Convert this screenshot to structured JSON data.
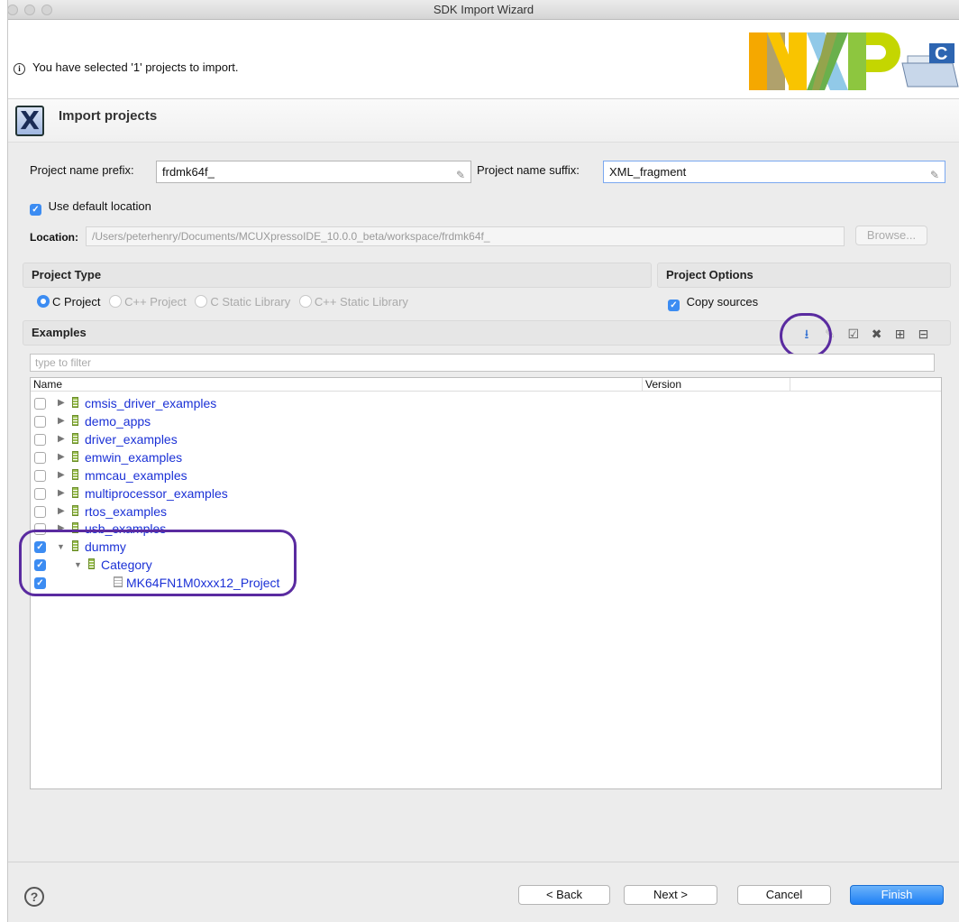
{
  "window": {
    "title": "SDK Import Wizard"
  },
  "header": {
    "message": "You have selected '1' projects to import."
  },
  "banner": {
    "title": "Import projects"
  },
  "form": {
    "prefix_label": "Project name prefix:",
    "prefix_value": "frdmk64f_",
    "suffix_label": "Project name suffix:",
    "suffix_value": "XML_fragment",
    "use_default_label": "Use default location",
    "use_default_checked": true,
    "location_label": "Location:",
    "location_value": "/Users/peterhenry/Documents/MCUXpressoIDE_10.0.0_beta/workspace/frdmk64f_",
    "browse_label": "Browse..."
  },
  "project_type": {
    "title": "Project Type",
    "options": [
      "C Project",
      "C++ Project",
      "C Static Library",
      "C++ Static Library"
    ],
    "selected": "C Project"
  },
  "project_options": {
    "title": "Project Options",
    "copy_sources_label": "Copy sources",
    "copy_sources_checked": true
  },
  "examples": {
    "title": "Examples",
    "filter_placeholder": "type to filter",
    "col_name": "Name",
    "col_version": "Version",
    "rows": [
      {
        "label": "cmsis_driver_examples",
        "checked": false,
        "level": 0,
        "expanded": false
      },
      {
        "label": "demo_apps",
        "checked": false,
        "level": 0,
        "expanded": false
      },
      {
        "label": "driver_examples",
        "checked": false,
        "level": 0,
        "expanded": false
      },
      {
        "label": "emwin_examples",
        "checked": false,
        "level": 0,
        "expanded": false
      },
      {
        "label": "mmcau_examples",
        "checked": false,
        "level": 0,
        "expanded": false
      },
      {
        "label": "multiprocessor_examples",
        "checked": false,
        "level": 0,
        "expanded": false
      },
      {
        "label": "rtos_examples",
        "checked": false,
        "level": 0,
        "expanded": false
      },
      {
        "label": "usb_examples",
        "checked": false,
        "level": 0,
        "expanded": false
      },
      {
        "label": "dummy",
        "checked": true,
        "level": 0,
        "expanded": true
      },
      {
        "label": "Category",
        "checked": true,
        "level": 1,
        "expanded": true
      },
      {
        "label": "MK64FN1M0xxx12_Project",
        "checked": true,
        "level": 2,
        "leaf": true
      }
    ]
  },
  "buttons": {
    "back": "< Back",
    "next": "Next >",
    "cancel": "Cancel",
    "finish": "Finish"
  },
  "colors": {
    "accent": "#3c8cf2",
    "highlight": "#5a2ba0",
    "link": "#1b31d6"
  }
}
